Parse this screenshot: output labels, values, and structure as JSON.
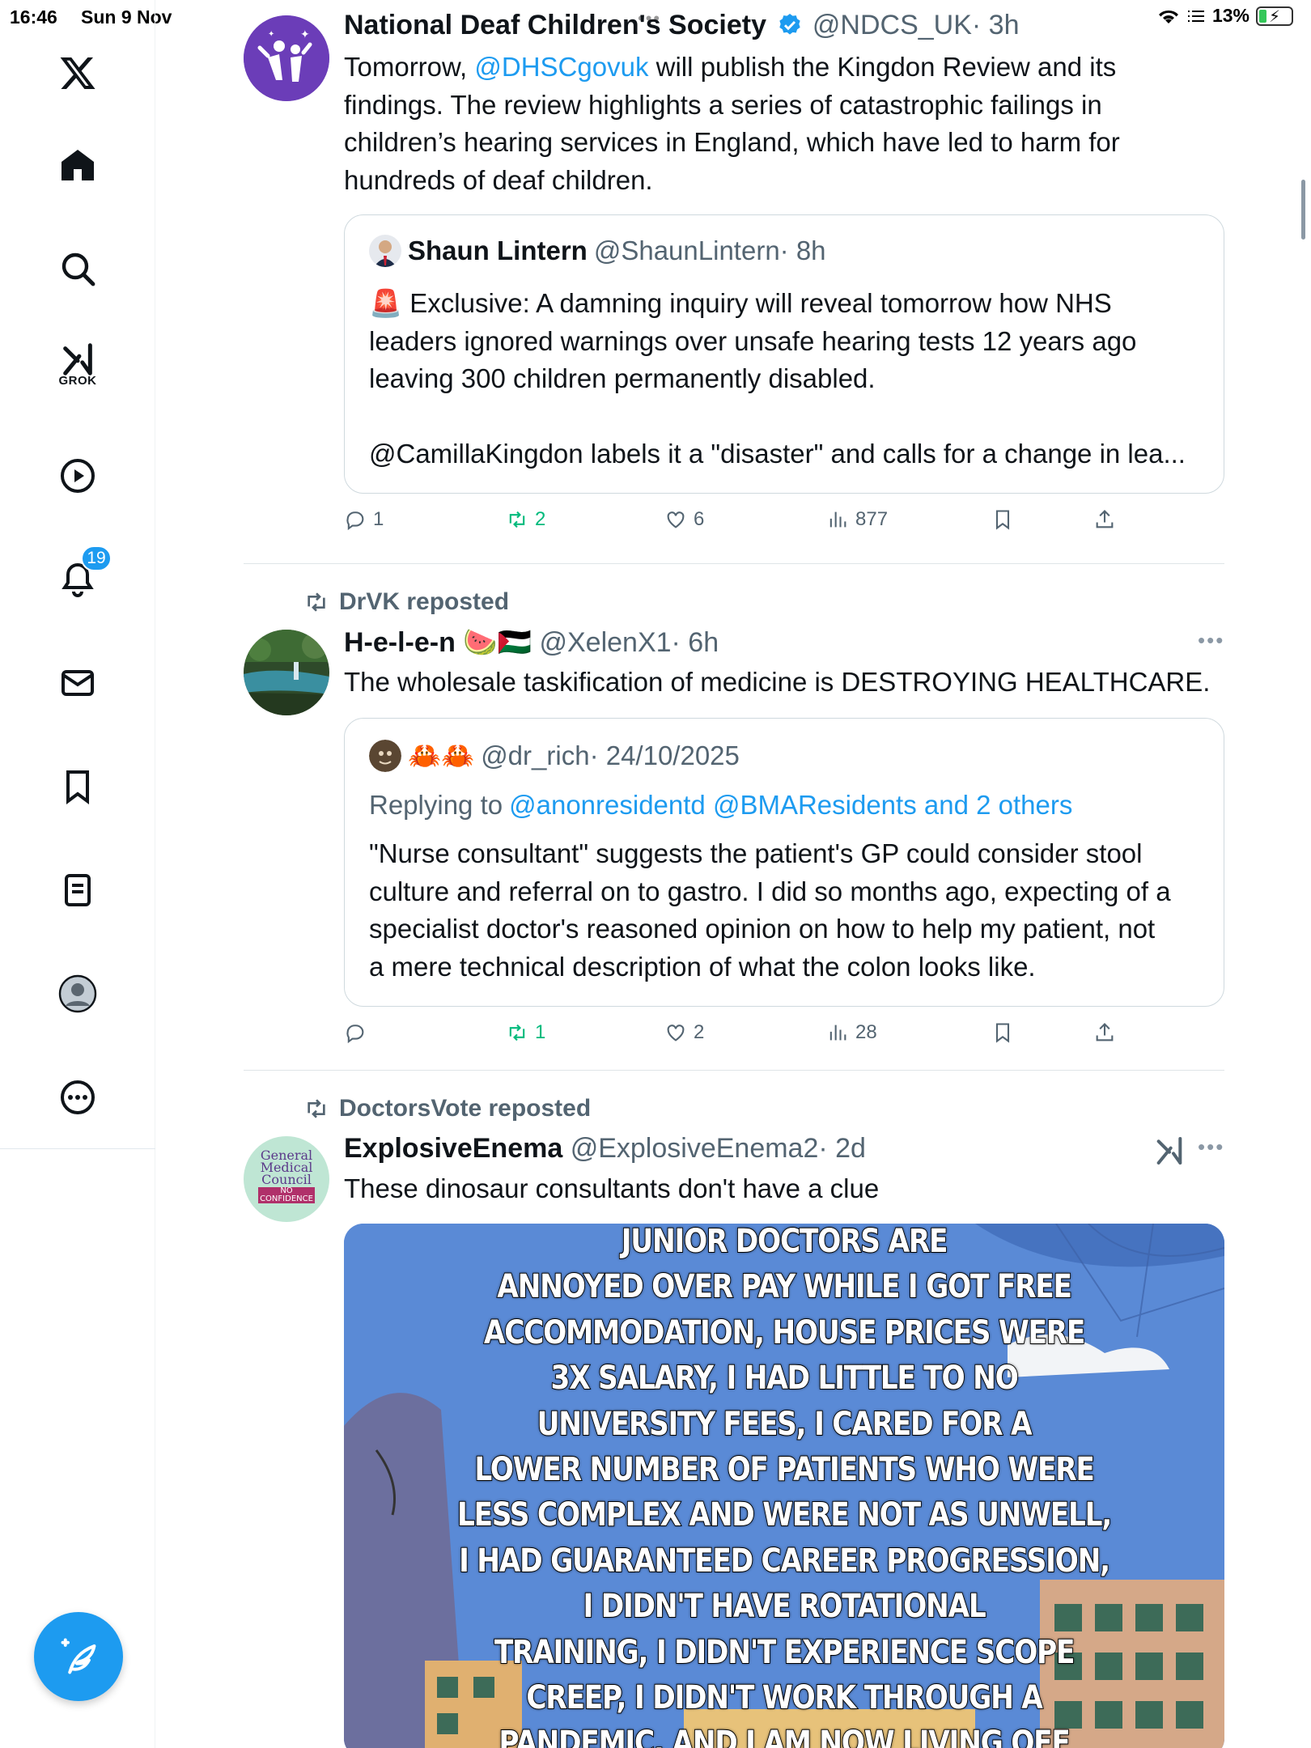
{
  "status_bar": {
    "time": "16:46",
    "date": "Sun 9 Nov",
    "battery": "13%"
  },
  "sidebar": {
    "grok_label": "GROK",
    "notification_count": "19"
  },
  "tweets": [
    {
      "name": "National Deaf Children's Society",
      "handle": "@NDCS_UK",
      "time": "· 3h",
      "verified": true,
      "text_prefix": "Tomorrow, ",
      "text_mention": "@DHSCgovuk",
      "text_line1_rest": " will publish the Kingdon Review and its",
      "text_rest": [
        "findings. The review highlights a series of catastrophic failings in",
        "children’s hearing services in England, which have led to harm for",
        "hundreds of deaf children."
      ],
      "quote": {
        "name": "Shaun Lintern",
        "handle": "@ShaunLintern",
        "time": "· 8h",
        "lines": [
          "🚨 Exclusive: A damning inquiry will reveal tomorrow how NHS",
          "leaders ignored warnings over unsafe hearing tests 12 years ago",
          "leaving 300 children permanently disabled.",
          "",
          "@CamillaKingdon labels it a \"disaster\" and calls for a change in lea..."
        ]
      },
      "actions": {
        "replies": "1",
        "reposts": "2",
        "likes": "6",
        "views": "877"
      }
    },
    {
      "reposted_by": "DrVK reposted",
      "name": "H-e-l-e-n",
      "name_emoji": "🍉🇵🇸",
      "handle": "@XelenX1",
      "time": "· 6h",
      "text": "The wholesale taskification of medicine is DESTROYING HEALTHCARE.",
      "quote": {
        "name_emoji": "🦀🦀",
        "handle": "@dr_rich",
        "time": "· 24/10/2025",
        "replying_prefix": "Replying to ",
        "replying_to": "@anonresidentd @BMAResidents and 2 others",
        "lines": [
          "\"Nurse consultant\" suggests the patient's GP could consider stool",
          "culture and referral on to gastro. I did so months ago, expecting of a",
          "specialist doctor's reasoned opinion on how to help my patient, not",
          "a mere technical description of what the colon looks like."
        ]
      },
      "actions": {
        "replies": "",
        "reposts": "1",
        "likes": "2",
        "views": "28"
      }
    },
    {
      "reposted_by": "DoctorsVote reposted",
      "name": "ExplosiveEnema",
      "handle": "@ExplosiveEnema2",
      "time": "· 2d",
      "text": "These dinosaur consultants don't have a clue",
      "avatar_text": [
        "General",
        "Medical",
        "Council",
        "NO",
        "CONFIDENCE"
      ],
      "meme_lines": [
        "JUNIOR DOCTORS ARE",
        "ANNOYED OVER PAY WHILE I GOT FREE",
        "ACCOMMODATION, HOUSE PRICES WERE",
        "3X SALARY, I HAD LITTLE TO NO",
        "UNIVERSITY FEES, I CARED FOR A",
        "LOWER NUMBER OF PATIENTS WHO WERE",
        "LESS COMPLEX AND WERE NOT AS UNWELL,",
        "I HAD GUARANTEED CAREER PROGRESSION,",
        "I DIDN'T HAVE ROTATIONAL",
        "TRAINING, I DIDN'T EXPERIENCE SCOPE",
        "CREEP, I DIDN'T WORK THROUGH A",
        "PANDEMIC, AND I AM NOW LIVING OFF"
      ]
    }
  ],
  "colors": {
    "accent": "#1d9bf0",
    "repost": "#00ba7c",
    "muted": "#536471"
  }
}
